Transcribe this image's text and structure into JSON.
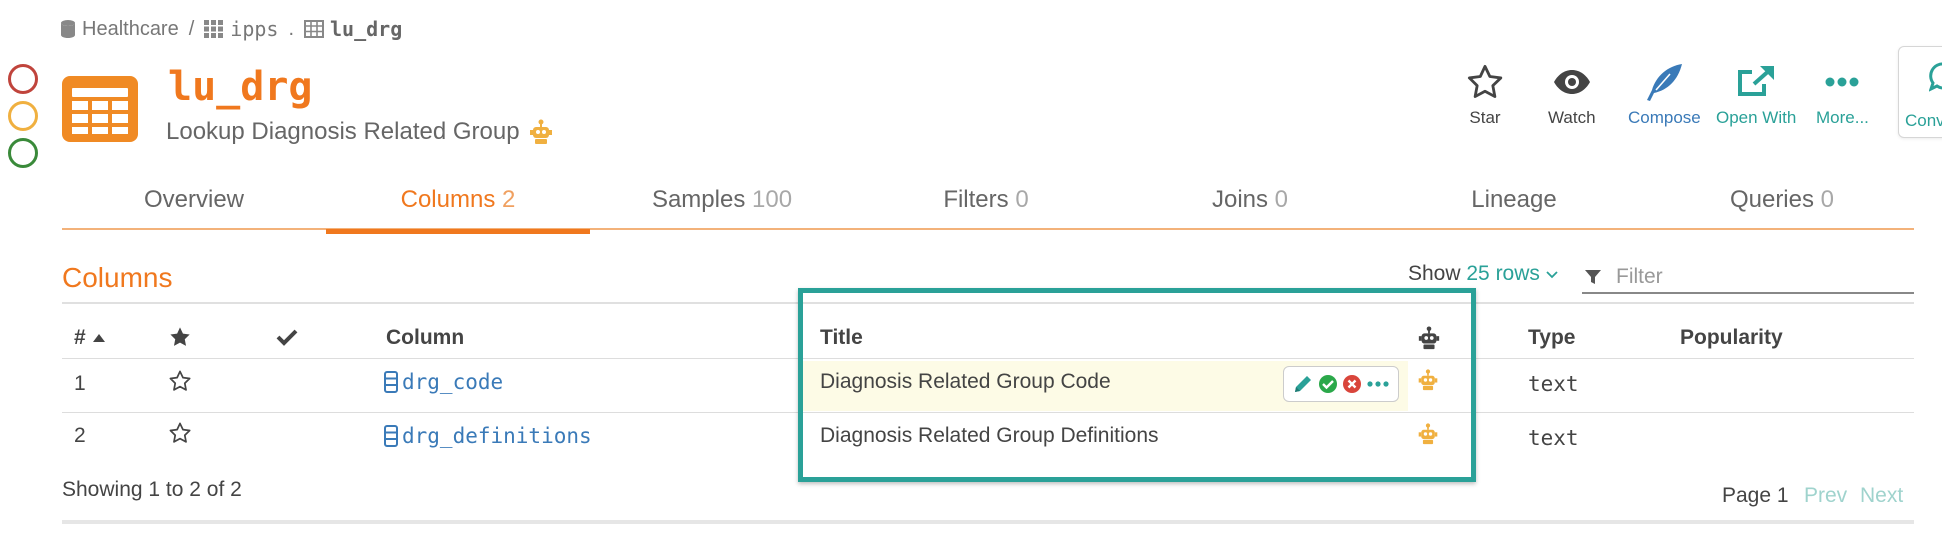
{
  "breadcrumb": {
    "database": "Healthcare",
    "sep1": "/",
    "schema": "ipps",
    "sep2": ".",
    "table": "lu_drg"
  },
  "header": {
    "title": "lu_drg",
    "subtitle": "Lookup Diagnosis Related Group"
  },
  "actions": {
    "star": "Star",
    "watch": "Watch",
    "compose": "Compose",
    "open_with": "Open With",
    "more": "More...",
    "converse": "Conv"
  },
  "tabs": [
    {
      "label": "Overview",
      "count": ""
    },
    {
      "label": "Columns",
      "count": "2"
    },
    {
      "label": "Samples",
      "count": "100"
    },
    {
      "label": "Filters",
      "count": "0"
    },
    {
      "label": "Joins",
      "count": "0"
    },
    {
      "label": "Lineage",
      "count": ""
    },
    {
      "label": "Queries",
      "count": "0"
    }
  ],
  "section": {
    "title": "Columns",
    "show_label": "Show",
    "rows_label": "25 rows",
    "filter_placeholder": "Filter"
  },
  "table": {
    "headers": {
      "num": "#",
      "column": "Column",
      "title": "Title",
      "type": "Type",
      "popularity": "Popularity"
    },
    "rows": [
      {
        "num": "1",
        "column": "drg_code",
        "title": "Diagnosis Related Group Code",
        "type": "text"
      },
      {
        "num": "2",
        "column": "drg_definitions",
        "title": "Diagnosis Related Group Definitions",
        "type": "text"
      }
    ]
  },
  "footer": {
    "showing": "Showing 1 to 2 of 2",
    "page": "Page 1",
    "prev": "Prev",
    "next": "Next"
  },
  "colors": {
    "accent_orange": "#f0781e",
    "teal": "#2aa198",
    "link_blue": "#3a7ab8",
    "circle_red": "#c0443c",
    "circle_yellow": "#f0b040",
    "circle_green": "#3a8a3a"
  },
  "icons": [
    "database-icon",
    "grid-icon",
    "table-icon",
    "robot-icon",
    "star-outline-icon",
    "eye-icon",
    "feather-icon",
    "external-link-icon",
    "more-icon",
    "filter-icon",
    "sort-up-icon",
    "star-icon",
    "check-icon",
    "column-icon",
    "pencil-icon",
    "check-circle-icon",
    "close-circle-icon"
  ]
}
